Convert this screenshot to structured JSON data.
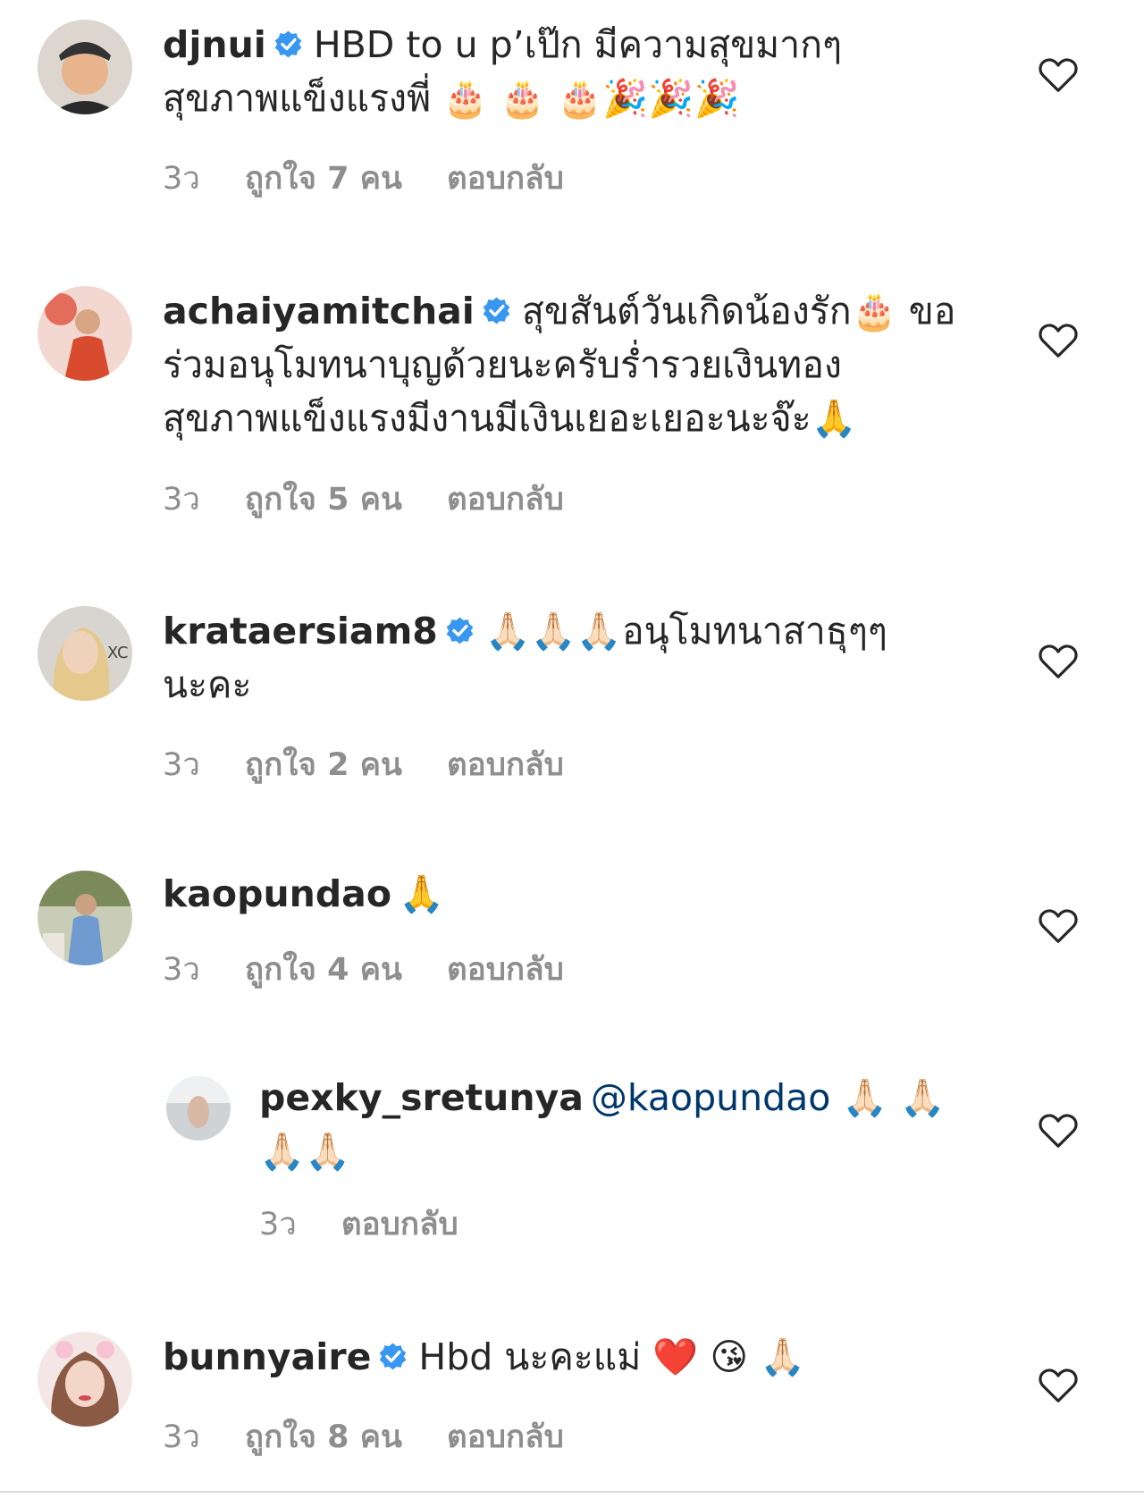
{
  "comments": [
    {
      "username": "djnui",
      "verified": true,
      "text": "HBD to u p’เป๊ก  มีความสุขมากๆ สุขภาพแข็งแรงพี่ 🎂 🎂 🎂🎉🎉🎉",
      "time": "3ว",
      "likes": "ถูกใจ 7 คน",
      "reply": "ตอบกลับ"
    },
    {
      "username": "achaiyamitchai",
      "verified": true,
      "text": "สุขสันต์วันเกิดน้องรัก🎂 ขอร่วมอนุโมทนาบุญด้วยนะครับร่ำรวยเงินทอง สุขภาพแข็งแรงมีงานมีเงินเยอะเยอะนะจ๊ะ🙏",
      "time": "3ว",
      "likes": "ถูกใจ 5 คน",
      "reply": "ตอบกลับ"
    },
    {
      "username": "krataersiam8",
      "verified": true,
      "text": "🙏🏻🙏🏻🙏🏻อนุโมทนาสาธุๆๆ นะคะ",
      "time": "3ว",
      "likes": "ถูกใจ 2 คน",
      "reply": "ตอบกลับ"
    },
    {
      "username": "kaopundao",
      "verified": false,
      "text": "🙏",
      "time": "3ว",
      "likes": "ถูกใจ 4 คน",
      "reply": "ตอบกลับ"
    },
    {
      "username": "pexky_sretunya",
      "verified": false,
      "mention": "@kaopundao",
      "text": "🙏🏻 🙏🏻🙏🏻🙏🏻",
      "time": "3ว",
      "reply": "ตอบกลับ"
    },
    {
      "username": "bunnyaire",
      "verified": true,
      "text": "Hbd นะคะแม่ ❤️ 😘 🙏🏻",
      "time": "3ว",
      "likes": "ถูกใจ 8 คน",
      "reply": "ตอบกลับ"
    }
  ],
  "icons": {
    "verified": "verified-badge-icon",
    "like": "heart-outline-icon"
  },
  "colors": {
    "verified": "#3897f0",
    "meta": "#8e8e8e",
    "mention": "#00376b"
  }
}
